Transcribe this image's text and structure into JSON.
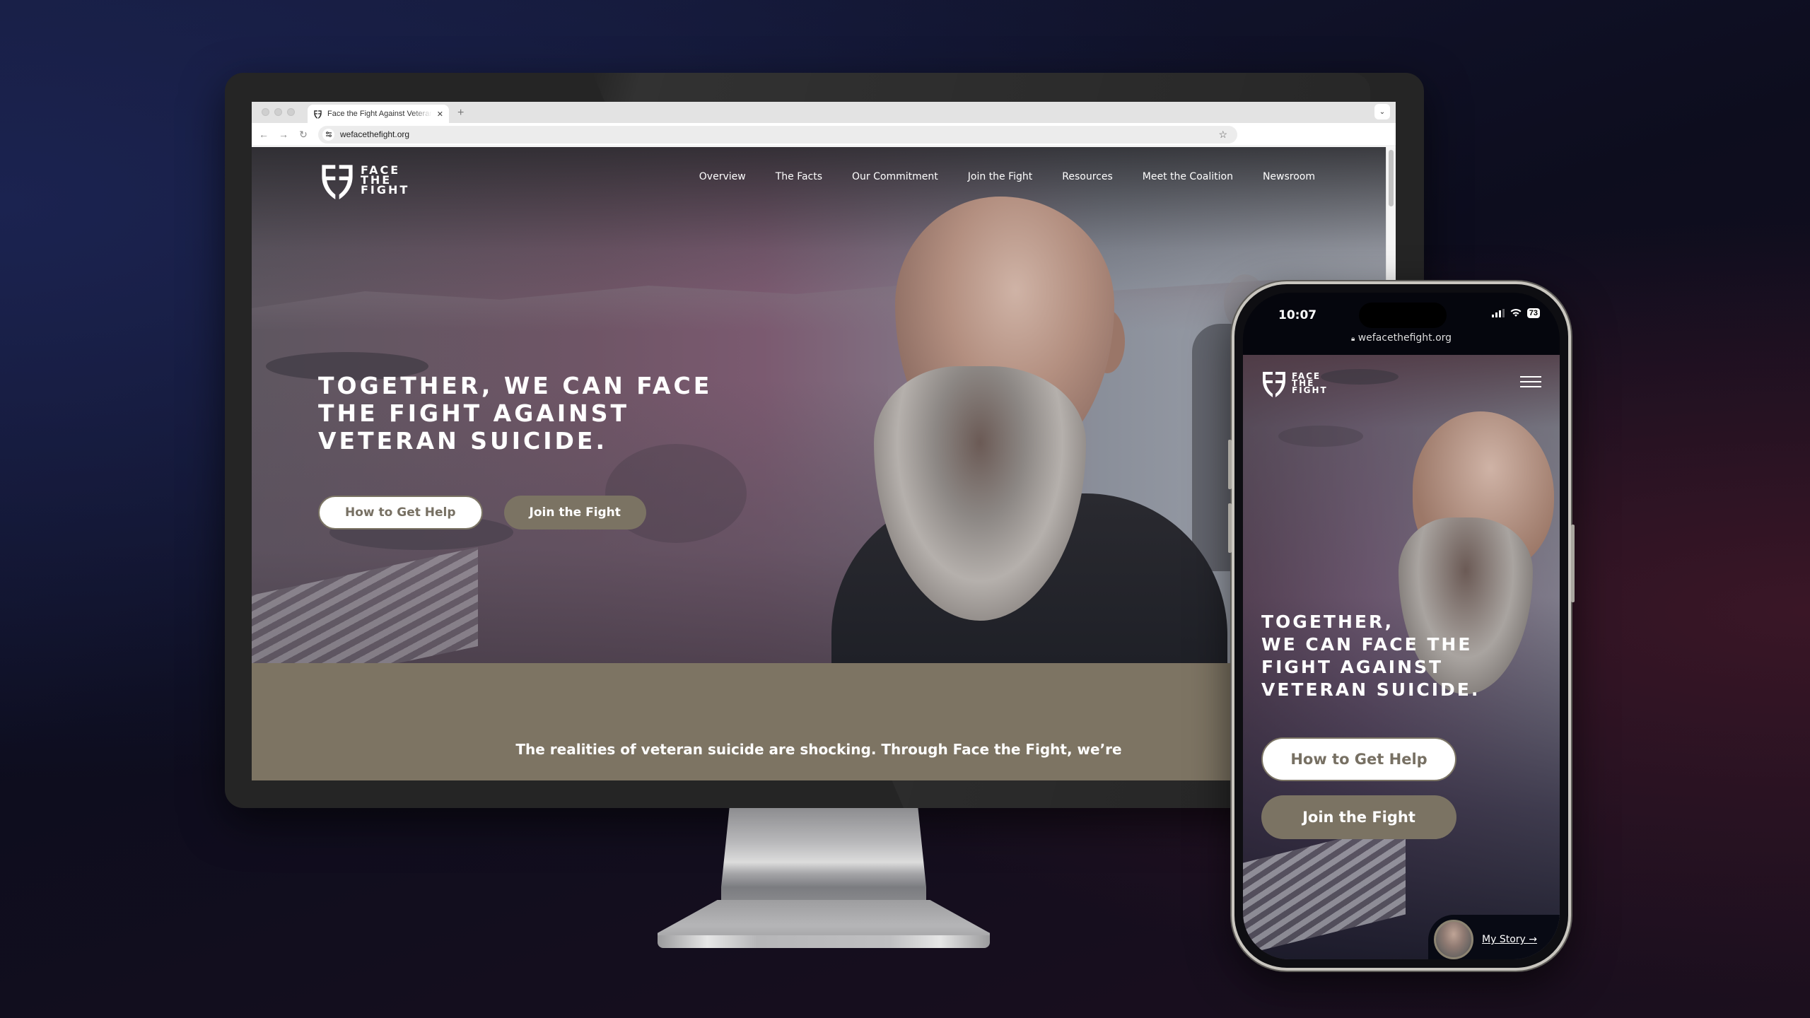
{
  "browser": {
    "tab_title": "Face the Fight Against Veteran Suicide",
    "tab_close": "✕",
    "new_tab": "+",
    "tabs_menu_icon": "⌄",
    "back_icon": "←",
    "forward_icon": "→",
    "reload_icon": "↻",
    "site_settings_icon": "⚙",
    "url": "wefacethefight.org",
    "bookmark_icon": "☆"
  },
  "site": {
    "logo_lines": [
      "FACE",
      "THE",
      "FIGHT"
    ],
    "nav": [
      "Overview",
      "The Facts",
      "Our Commitment",
      "Join the Fight",
      "Resources",
      "Meet the Coalition",
      "Newsroom"
    ],
    "hero_title": "Together, we can face the fight against veteran suicide.",
    "buttons": {
      "help": "How to Get Help",
      "join": "Join the Fight"
    },
    "band_text": "The realities of veteran suicide are shocking. Through Face the Fight, we’re"
  },
  "phone": {
    "time": "10:07",
    "battery": "73",
    "url": "wefacethefight.org",
    "lock_icon": "🔒",
    "wifi_icon": "wifi",
    "logo_lines": [
      "FACE",
      "THE",
      "FIGHT"
    ],
    "hero_title_lines": [
      "Together,",
      "we can face the",
      "fight against",
      "veteran suicide."
    ],
    "buttons": {
      "help": "How to Get Help",
      "join": "Join the Fight"
    },
    "story_link": "My Story →"
  },
  "colors": {
    "brand_olive": "#7b7363",
    "band": "#7d7463",
    "button_text_olive": "#777063",
    "white": "#ffffff"
  }
}
